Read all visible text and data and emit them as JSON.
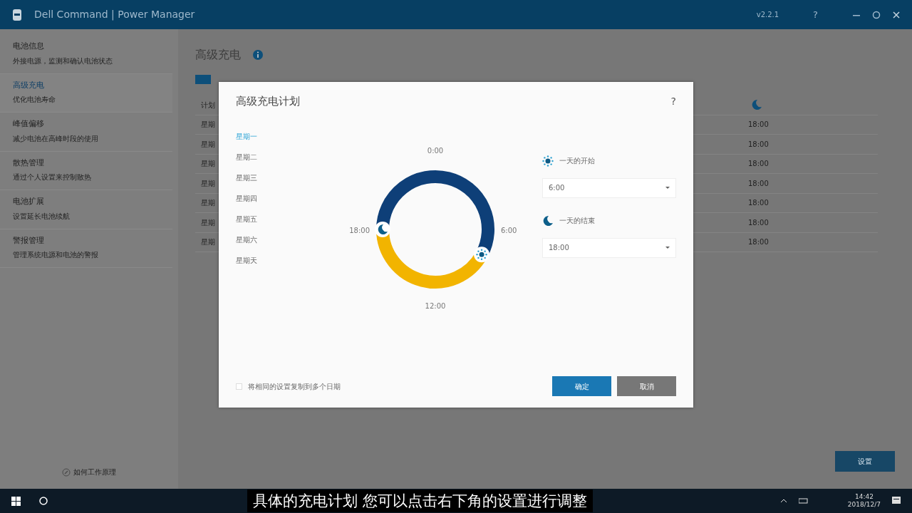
{
  "window": {
    "title": "Dell Command | Power Manager",
    "version": "v2.2.1",
    "help": "?"
  },
  "sidebar": {
    "items": [
      {
        "title": "电池信息",
        "subtitle": "外接电源，监测和确认电池状态",
        "selected": false
      },
      {
        "title": "高级充电",
        "subtitle": "优化电池寿命",
        "selected": true
      },
      {
        "title": "峰值偏移",
        "subtitle": "减少电池在高峰时段的使用",
        "selected": false
      },
      {
        "title": "散热管理",
        "subtitle": "通过个人设置来控制散热",
        "selected": false
      },
      {
        "title": "电池扩展",
        "subtitle": "设置延长电池续航",
        "selected": false
      },
      {
        "title": "警报管理",
        "subtitle": "管理系统电源和电池的警报",
        "selected": false
      }
    ],
    "footer_link": "如何工作原理"
  },
  "page": {
    "title": "高级充电",
    "toggle": {
      "on": true
    },
    "table": {
      "columns": [
        "计划"
      ],
      "rows": [
        {
          "day": "星期",
          "end": "18:00"
        },
        {
          "day": "星期",
          "end": "18:00"
        },
        {
          "day": "星期",
          "end": "18:00"
        },
        {
          "day": "星期",
          "end": "18:00"
        },
        {
          "day": "星期",
          "end": "18:00"
        },
        {
          "day": "星期",
          "end": "18:00"
        },
        {
          "day": "星期",
          "end": "18:00"
        }
      ]
    },
    "settings_button": "设置"
  },
  "dialog": {
    "title": "高级充电计划",
    "help": "?",
    "days": [
      {
        "label": "星期一",
        "selected": true
      },
      {
        "label": "星期二",
        "selected": false
      },
      {
        "label": "星期三",
        "selected": false
      },
      {
        "label": "星期四",
        "selected": false
      },
      {
        "label": "星期五",
        "selected": false
      },
      {
        "label": "星期六",
        "selected": false
      },
      {
        "label": "星期天",
        "selected": false
      }
    ],
    "dial_labels": [
      "0:00",
      "6:00",
      "12:00",
      "18:00"
    ],
    "start": {
      "label": "一天的开始",
      "value": "6:00"
    },
    "end": {
      "label": "一天的结束",
      "value": "18:00"
    },
    "copy_checkbox": {
      "label": "将相同的设置复制到多个日期",
      "checked": false
    },
    "buttons": [
      {
        "label": "确定",
        "kind": "primary"
      },
      {
        "label": "取消",
        "kind": "secondary"
      }
    ]
  },
  "caption": "具体的充电计划 您可以点击右下角的设置进行调整",
  "taskbar": {
    "time": "14:42",
    "date": "2018/12/7"
  }
}
